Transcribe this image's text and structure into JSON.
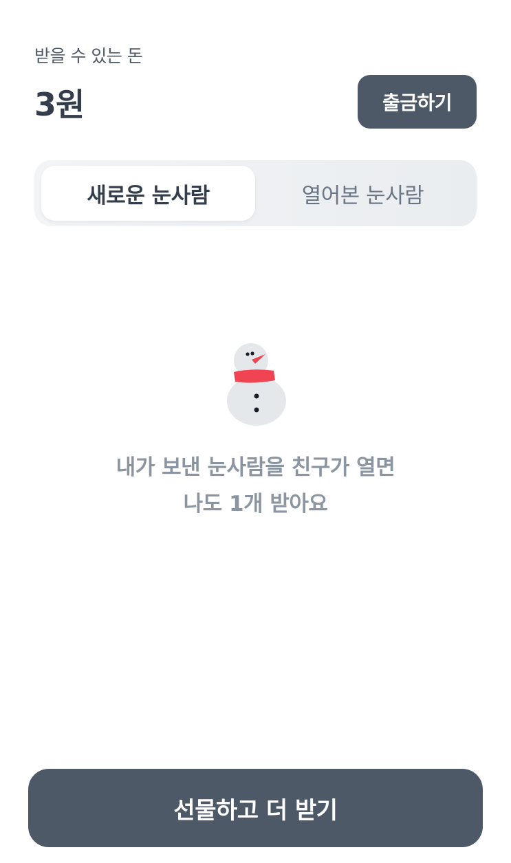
{
  "balance": {
    "label": "받을 수 있는 돈",
    "amount": "3원",
    "withdraw_label": "출금하기"
  },
  "tabs": [
    {
      "label": "새로운 눈사람",
      "selected": true
    },
    {
      "label": "열어본 눈사람",
      "selected": false
    }
  ],
  "empty_state": {
    "icon": "snowman-icon",
    "line1": "내가 보낸 눈사람을 친구가 열면",
    "line2": "나도 1개 받아요"
  },
  "cta": {
    "label": "선물하고 더 받기"
  },
  "colors": {
    "primary_button": "#4e5968",
    "text_dark": "#333d4b",
    "text_muted": "#8b95a1",
    "scarf": "#f04452",
    "nose": "#f04452",
    "snow": "#e5e8eb"
  }
}
